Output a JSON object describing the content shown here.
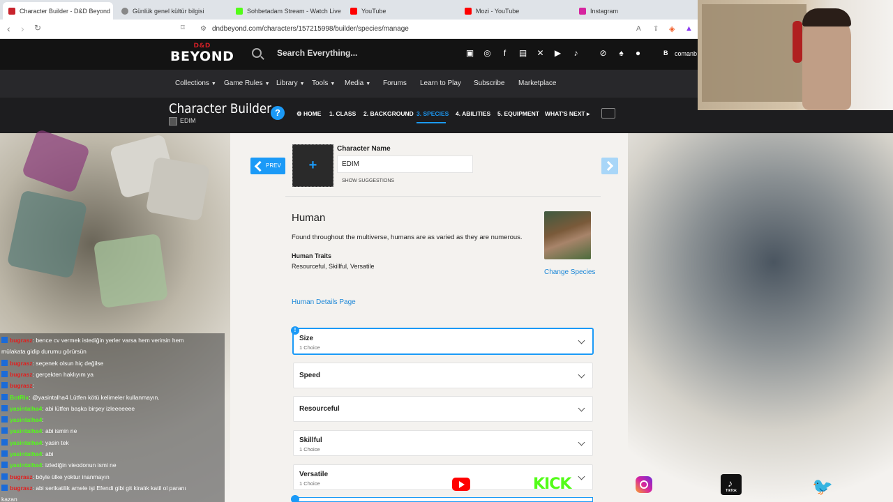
{
  "browser": {
    "tabs": [
      {
        "label": "Character Builder - D&D Beyond",
        "active": true,
        "close": "×",
        "favicon_color": "#c8232c"
      },
      {
        "label": "Günlük genel kültür bilgisi",
        "active": false,
        "favicon_color": "#888888"
      },
      {
        "label": "Sohbetadam Stream - Watch Live on",
        "active": false,
        "favicon_color": "#53fc18"
      },
      {
        "label": "YouTube",
        "active": false,
        "favicon_color": "#ff0000"
      },
      {
        "label": "Mozi - YouTube",
        "active": false,
        "favicon_color": "#ff0000"
      },
      {
        "label": "Instagram",
        "active": false,
        "favicon_color": "#d6249f"
      }
    ],
    "url": "dndbeyond.com/characters/157215998/builder/species/manage"
  },
  "site": {
    "logo_top": "D&D",
    "logo_bottom": "BEYOND",
    "search_placeholder": "Search Everything...",
    "user_initial": "B",
    "user_name": "comanb",
    "nav": [
      {
        "label": "Collections",
        "dropdown": true
      },
      {
        "label": "Game Rules",
        "dropdown": true
      },
      {
        "label": "Library",
        "dropdown": true
      },
      {
        "label": "Tools",
        "dropdown": true
      },
      {
        "label": "Media",
        "dropdown": true
      },
      {
        "label": "Forums",
        "dropdown": false
      },
      {
        "label": "Learn to Play",
        "dropdown": false
      },
      {
        "label": "Subscribe",
        "dropdown": false
      },
      {
        "label": "Marketplace",
        "dropdown": false
      }
    ],
    "social_icons": [
      "discord-icon",
      "instagram-icon",
      "facebook-icon",
      "twitch-icon",
      "x-icon",
      "youtube-icon",
      "tiktok-icon"
    ]
  },
  "builder": {
    "title": "Character Builder",
    "character_short": "EDIM",
    "help": "?",
    "steps": [
      {
        "label": "⚙ HOME",
        "active": false
      },
      {
        "label": "1. CLASS",
        "active": false
      },
      {
        "label": "2. BACKGROUND",
        "active": false
      },
      {
        "label": "3. SPECIES",
        "active": true
      },
      {
        "label": "4. ABILITIES",
        "active": false
      },
      {
        "label": "5. EQUIPMENT",
        "active": false
      },
      {
        "label": "WHAT'S NEXT ▸",
        "active": false
      }
    ]
  },
  "panel": {
    "prev_label": "PREV",
    "character_name_label": "Character Name",
    "character_name_value": "EDIM",
    "show_suggestions": "SHOW SUGGESTIONS",
    "species_title": "Human",
    "species_desc": "Found throughout the multiverse, humans are as varied as they are numerous.",
    "traits_heading": "Human Traits",
    "traits": "Resourceful, Skillful, Versatile",
    "change_species": "Change Species",
    "details_link": "Human Details Page",
    "alert": "!",
    "accordions": [
      {
        "title": "Size",
        "sub": "1 Choice",
        "selected": true
      },
      {
        "title": "Speed",
        "sub": "",
        "selected": false
      },
      {
        "title": "Resourceful",
        "sub": "",
        "selected": false
      },
      {
        "title": "Skillful",
        "sub": "1 Choice",
        "selected": false
      },
      {
        "title": "Versatile",
        "sub": "1 Choice",
        "selected": false
      }
    ]
  },
  "chat": [
    {
      "user": "bugrasz",
      "text": ": bence cv vermek istediğin yerler varsa hem verirsin hem",
      "color": "#e02020"
    },
    {
      "user": "",
      "text": "mülakata gidip durumu görürsün",
      "color": "#ffffff"
    },
    {
      "user": "bugrasz",
      "text": ": seçenek olsun hiç değilse",
      "color": "#e02020"
    },
    {
      "user": "bugrasz",
      "text": ": gerçekten haklıyım ya",
      "color": "#e02020"
    },
    {
      "user": "bugrasz",
      "text": ":",
      "color": "#e02020"
    },
    {
      "user": "BotRix",
      "text": ": @yasintalha4 Lütfen kötü kelimeler kullanmayın.",
      "color": "#53fc18"
    },
    {
      "user": "yasintalha4",
      "text": ": abi lütfen başka birşey izleeeeeee",
      "color": "#53fc18"
    },
    {
      "user": "yasintalha4",
      "text": ":",
      "color": "#53fc18"
    },
    {
      "user": "yasintalha4",
      "text": ": abi ismin ne",
      "color": "#53fc18"
    },
    {
      "user": "yasintalha4",
      "text": ": yasin tek",
      "color": "#53fc18"
    },
    {
      "user": "yasintalha4",
      "text": ": abi",
      "color": "#53fc18"
    },
    {
      "user": "yasintalha4",
      "text": ": izlediğin vieodonun ismi ne",
      "color": "#53fc18"
    },
    {
      "user": "bugrasz",
      "text": ": böyle ülke yoktur inanmayın",
      "color": "#e02020"
    },
    {
      "user": "bugrasz",
      "text": ": abi serikatilik amele işi Efendi gibi git kiralık katil ol paranı",
      "color": "#e02020"
    },
    {
      "user": "",
      "text": "kazan",
      "color": "#ffffff"
    }
  ],
  "overlay": {
    "kick": "KICK",
    "tiktok": "TikTok"
  }
}
